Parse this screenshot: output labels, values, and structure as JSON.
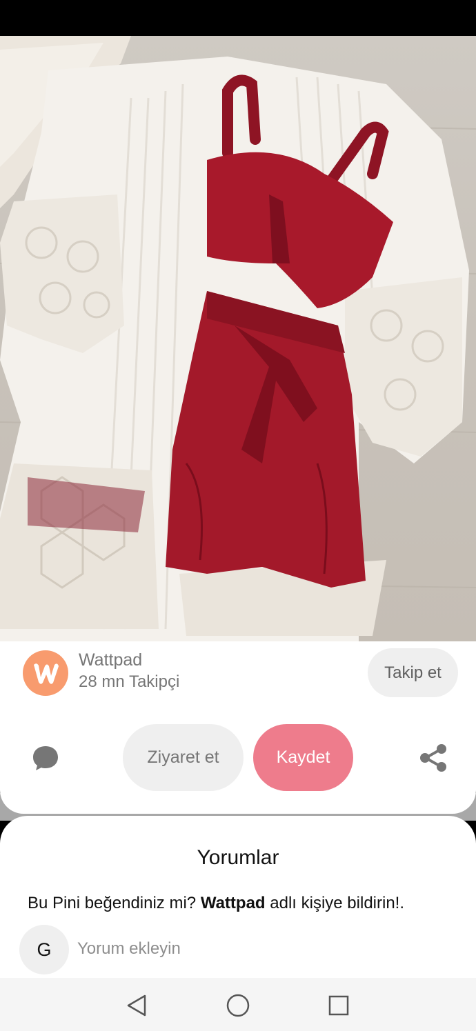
{
  "pin": {
    "image_alt": "Red braided-strap crop top and red paperbag shorts with white lace kimono cardigan on a wooden floor"
  },
  "creator": {
    "name": "Wattpad",
    "followers": "28 mn Takipçi",
    "avatar_icon": "wattpad-logo-icon",
    "avatar_color": "#f89b6e"
  },
  "actions": {
    "follow_label": "Takip et",
    "visit_label": "Ziyaret et",
    "save_label": "Kaydet",
    "comment_icon": "comment-bubble-icon",
    "share_icon": "share-icon",
    "save_color": "#ee7c8c"
  },
  "comments": {
    "title": "Yorumlar",
    "prompt_before": "Bu Pini beğendiniz mi? ",
    "prompt_name": "Wattpad",
    "prompt_after": " adlı kişiye bildirin!.",
    "user_initial": "G",
    "input_placeholder": "Yorum ekleyin"
  },
  "navbar": {
    "back_icon": "back-triangle-icon",
    "home_icon": "home-circle-icon",
    "recents_icon": "recents-square-icon"
  }
}
